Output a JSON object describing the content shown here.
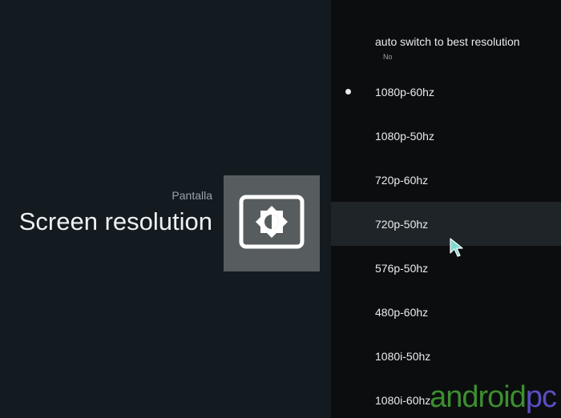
{
  "header": {
    "breadcrumb": "Pantalla",
    "title": "Screen resolution"
  },
  "icon": {
    "name": "display-brightness-icon"
  },
  "options": [
    {
      "label": "auto switch to best resolution",
      "sub": "No",
      "selected": false,
      "focused": false
    },
    {
      "label": "1080p-60hz",
      "selected": true,
      "focused": false
    },
    {
      "label": "1080p-50hz",
      "selected": false,
      "focused": false
    },
    {
      "label": "720p-60hz",
      "selected": false,
      "focused": false
    },
    {
      "label": "720p-50hz",
      "selected": false,
      "focused": true
    },
    {
      "label": "576p-50hz",
      "selected": false,
      "focused": false
    },
    {
      "label": "480p-60hz",
      "selected": false,
      "focused": false
    },
    {
      "label": "1080i-50hz",
      "selected": false,
      "focused": false
    },
    {
      "label": "1080i-60hz",
      "selected": false,
      "focused": false
    }
  ],
  "watermark": {
    "part1": "android",
    "part2": "pc"
  },
  "colors": {
    "background": "#0f1418",
    "list_background": "#0b0d0f",
    "focus_highlight": "#1e2428",
    "icon_tile": "#575d5e",
    "cursor": "#7fd8d0",
    "watermark_green": "#3d8f2e",
    "watermark_purple": "#5a4ec2"
  }
}
